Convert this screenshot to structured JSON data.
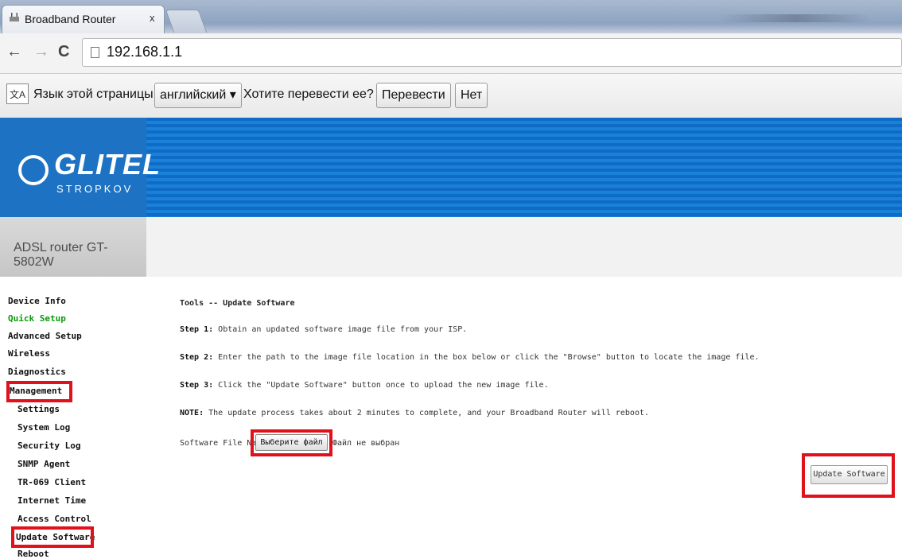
{
  "browser": {
    "tab_title": "Broadband Router",
    "tab_close": "x",
    "url": "192.168.1.1",
    "back": "←",
    "forward": "→",
    "reload": "C"
  },
  "translate_bar": {
    "icon_glyph": "文A",
    "page_language_label": "Язык этой страницы",
    "language_select": "английский ▾",
    "question": "Хотите перевести ее?",
    "translate_button": "Перевести",
    "no_button": "Нет"
  },
  "router": {
    "logo": "GLITEL",
    "logo_sub": "STROPKOV",
    "model": "ADSL router GT-5802W"
  },
  "sidebar": {
    "items": [
      {
        "label": "Device Info"
      },
      {
        "label": "Quick Setup"
      },
      {
        "label": "Advanced Setup"
      },
      {
        "label": "Wireless"
      },
      {
        "label": "Diagnostics"
      },
      {
        "label": "Management"
      },
      {
        "label": "Settings"
      },
      {
        "label": "System Log"
      },
      {
        "label": "Security Log"
      },
      {
        "label": "SNMP Agent"
      },
      {
        "label": "TR-069 Client"
      },
      {
        "label": "Internet Time"
      },
      {
        "label": "Access Control"
      },
      {
        "label": "Update Software"
      },
      {
        "label": "Reboot"
      }
    ]
  },
  "main": {
    "title": "Tools -- Update Software",
    "step1_label": "Step 1:",
    "step1_text": " Obtain an updated software image file from your ISP.",
    "step2_label": "Step 2:",
    "step2_text": " Enter the path to the image file location in the box below or click the \"Browse\" button to locate the image file.",
    "step3_label": "Step 3:",
    "step3_text": " Click the \"Update Software\" button once to upload the new image file.",
    "note_label": "NOTE:",
    "note_text": " The update process takes about 2 minutes to complete, and your Broadband Router will reboot.",
    "file_label": "Software File Name:",
    "choose_file_button": "Выберите файл",
    "no_file": "Файл не выбран",
    "update_button": "Update Software"
  },
  "colors": {
    "highlight": "#e0111b",
    "banner": "#1a80d8",
    "quick_setup": "#0a9a0a"
  }
}
